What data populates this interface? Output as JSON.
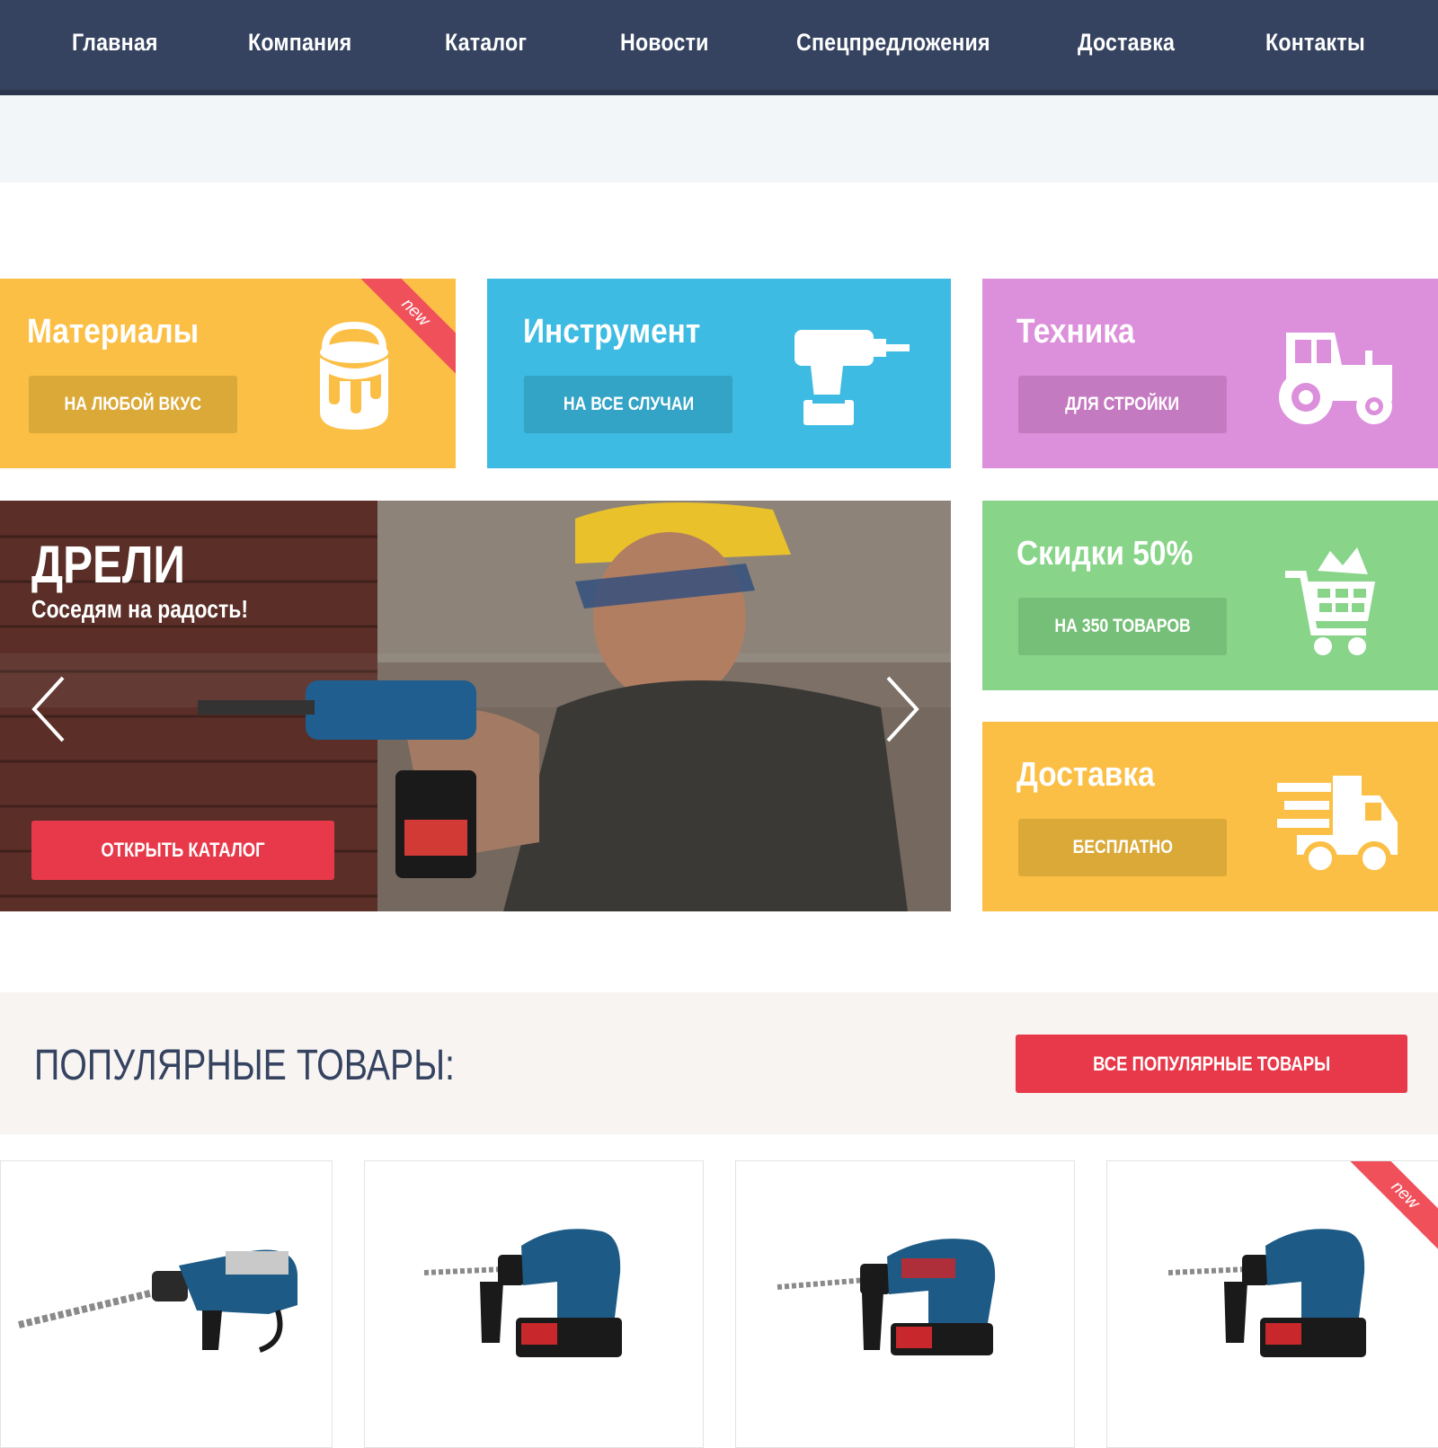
{
  "nav": {
    "items": [
      "Главная",
      "Компания",
      "Каталог",
      "Новости",
      "Спецпредложения",
      "Доставка",
      "Контакты"
    ]
  },
  "tiles": {
    "materials": {
      "title": "Материалы",
      "button": "На любой вкус",
      "badge": "new",
      "icon": "paint-bucket-icon",
      "color": "#fbbf46",
      "button_color": "#dba938"
    },
    "tools": {
      "title": "Инструмент",
      "button": "На все случаи",
      "icon": "drill-icon",
      "color": "#3ebbe2",
      "button_color": "#33a3c6"
    },
    "machinery": {
      "title": "Техника",
      "button": "Для стройки",
      "icon": "tractor-icon",
      "color": "#dc8fda",
      "button_color": "#c47ac0"
    },
    "discounts": {
      "title": "Скидки 50%",
      "button": "На 350 товаров",
      "icon": "cart-icon",
      "color": "#88d489",
      "button_color": "#76bf78"
    },
    "delivery": {
      "title": "Доставка",
      "button": "Бесплатно",
      "icon": "truck-icon",
      "color": "#fbbf46",
      "button_color": "#dba938"
    }
  },
  "hero": {
    "title": "ДРЕЛИ",
    "subtitle": "Соседям на радость!",
    "button": "ОТКРЫТЬ КАТАЛОГ"
  },
  "popular": {
    "title": "ПОПУЛЯРНЫЕ ТОВАРЫ:",
    "button": "ВСЕ ПОПУЛЯРНЫЕ ТОВАРЫ",
    "products": [
      {
        "icon": "rotary-hammer-icon"
      },
      {
        "icon": "cordless-hammer-icon"
      },
      {
        "icon": "cordless-hammer-icon"
      },
      {
        "icon": "cordless-hammer-icon",
        "badge": "new"
      }
    ]
  },
  "colors": {
    "nav": "#354360",
    "accent_red": "#e8394a",
    "ribbon": "#f0505a"
  }
}
